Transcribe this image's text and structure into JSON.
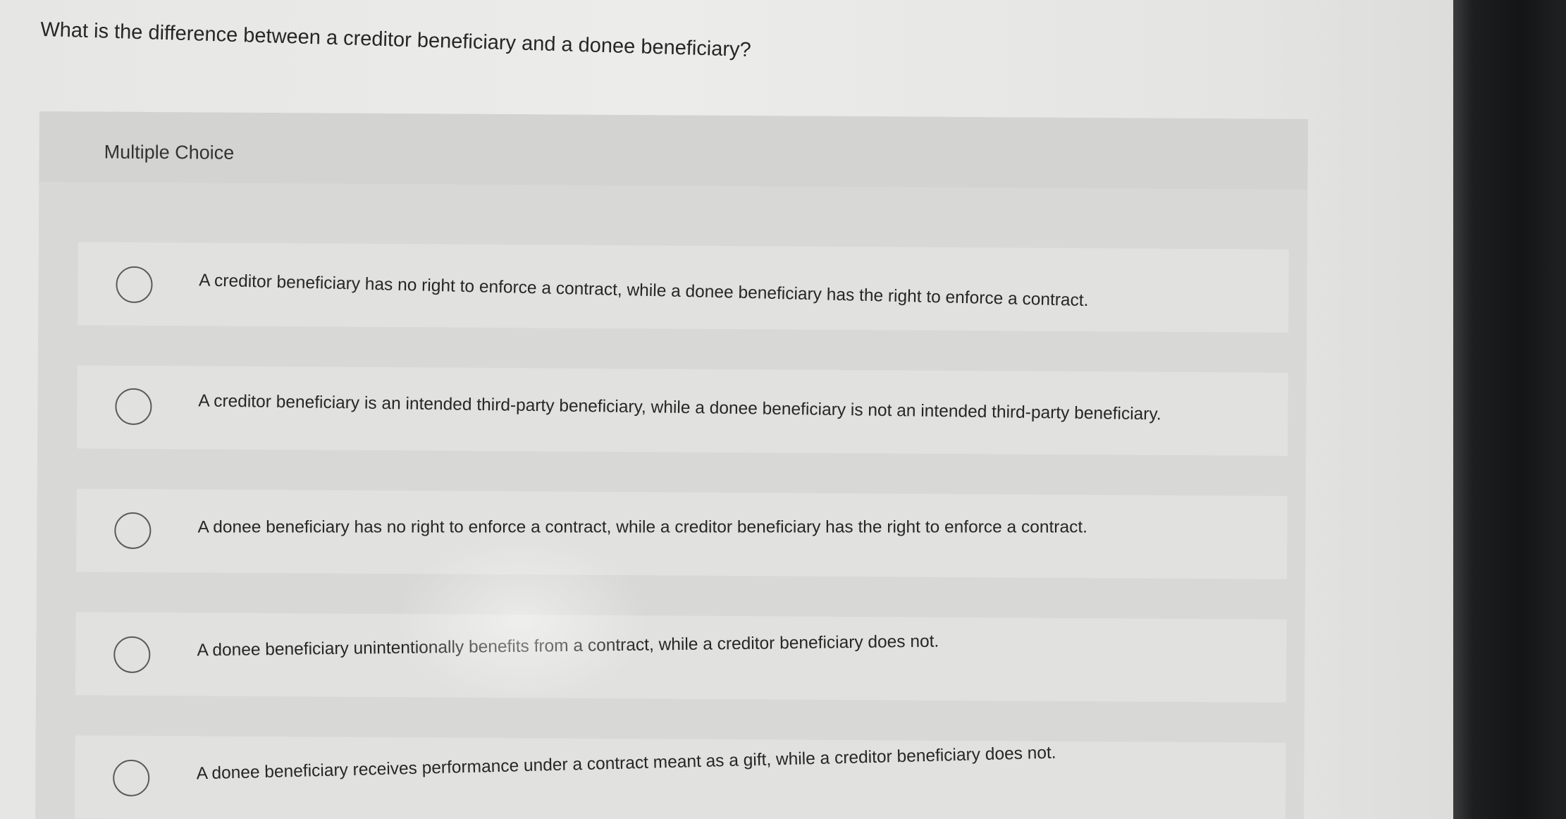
{
  "question": {
    "text": "What is the difference between a creditor beneficiary and a donee beneficiary?"
  },
  "multiple_choice": {
    "label": "Multiple Choice",
    "options": [
      {
        "text": "A creditor beneficiary has no right to enforce a contract, while a donee beneficiary has the right to enforce a contract.",
        "selected": false
      },
      {
        "text": "A creditor beneficiary is an intended third-party beneficiary, while a donee beneficiary is not an intended third-party beneficiary.",
        "selected": false
      },
      {
        "text": "A donee beneficiary has no right to enforce a contract, while a creditor beneficiary has the right to enforce a contract.",
        "selected": false
      },
      {
        "text": "A donee beneficiary unintentionally benefits from a contract, while a creditor beneficiary does not.",
        "selected": false
      },
      {
        "text": "A donee beneficiary receives performance under a contract meant as a gift, while a creditor beneficiary does not.",
        "selected": false
      }
    ]
  },
  "colors": {
    "page_background": "#e8e8e6",
    "panel_background": "#d8d8d6",
    "option_background": "#e1e1df",
    "radio_border": "#5a5a5a",
    "text": "#262626"
  }
}
